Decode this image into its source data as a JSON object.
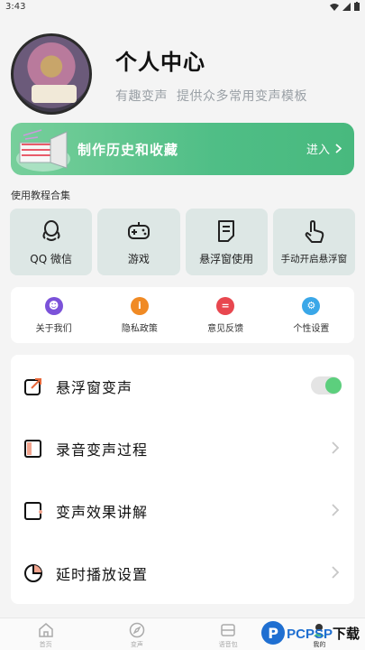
{
  "status_bar": {
    "time": "3:43"
  },
  "profile": {
    "title": "个人中心",
    "subtitle_parts": [
      "有趣变声",
      "提供众多常用变声模板"
    ]
  },
  "history_card": {
    "title": "制作历史和收藏",
    "enter_label": "进入"
  },
  "tutorials": {
    "section_label": "使用教程合集",
    "items": [
      {
        "label": "QQ 微信",
        "icon": "qq-icon"
      },
      {
        "label": "游戏",
        "icon": "gamepad-icon"
      },
      {
        "label": "悬浮窗使用",
        "icon": "document-icon"
      },
      {
        "label": "手动开启悬浮窗",
        "icon": "hand-pointer-icon"
      }
    ]
  },
  "quick_links": [
    {
      "label": "关于我们",
      "icon": "about-icon",
      "color": "#7b52d9"
    },
    {
      "label": "隐私政策",
      "icon": "info-icon",
      "color": "#f08a24"
    },
    {
      "label": "意见反馈",
      "icon": "feedback-icon",
      "color": "#e8474f"
    },
    {
      "label": "个性设置",
      "icon": "settings-icon",
      "color": "#3aa7e8"
    }
  ],
  "settings": [
    {
      "label": "悬浮窗变声",
      "control": "toggle",
      "toggle_on": true
    },
    {
      "label": "录音变声过程",
      "control": "chevron"
    },
    {
      "label": "变声效果讲解",
      "control": "chevron"
    },
    {
      "label": "延时播放设置",
      "control": "chevron"
    }
  ],
  "tabbar": [
    {
      "label": "首页",
      "icon": "home-icon",
      "active": false
    },
    {
      "label": "变声",
      "icon": "compass-icon",
      "active": false
    },
    {
      "label": "语音包",
      "icon": "inbox-icon",
      "active": false
    },
    {
      "label": "我的",
      "icon": "profile-icon",
      "active": true
    }
  ],
  "watermark": {
    "logo_letter": "P",
    "text_colored": "PCPSP",
    "text_dark": "下载"
  },
  "colors": {
    "accent_green": "#4fbe86",
    "toggle_green": "#5ccf7d",
    "tutorial_bg": "#dde7e5"
  }
}
